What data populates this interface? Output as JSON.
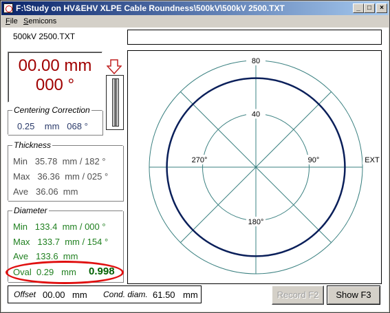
{
  "window": {
    "title": "F:\\Study on HV&EHV XLPE Cable Roundness\\500kV\\500kV 2500.TXT",
    "minimize": "_",
    "maximize": "□",
    "close": "×"
  },
  "menu": [
    {
      "label": "File",
      "accel": "F"
    },
    {
      "label": "Semicons",
      "accel": "S"
    }
  ],
  "file_label": "500kV 2500.TXT",
  "status_text": "",
  "reading": {
    "line1": "00.00 mm",
    "line2": "000  °"
  },
  "centering": {
    "legend": "Centering Correction",
    "value": "0.25",
    "unit": "mm",
    "angle": "068 °"
  },
  "thickness": {
    "legend": "Thickness",
    "rows": [
      {
        "label": "Min",
        "value": "35.78",
        "unit": "mm / 182 °"
      },
      {
        "label": "Max",
        "value": "36.36",
        "unit": "mm / 025 °"
      },
      {
        "label": "Ave",
        "value": "36.06",
        "unit": "mm"
      }
    ]
  },
  "diameter": {
    "legend": "Diameter",
    "rows": [
      {
        "label": "Min",
        "value": "133.4",
        "unit": "mm / 000 °"
      },
      {
        "label": "Max",
        "value": "133.7",
        "unit": "mm / 154 °"
      },
      {
        "label": "Ave",
        "value": "133.6",
        "unit": "mm"
      }
    ],
    "oval": {
      "label": "Oval",
      "value": "0.29",
      "unit": "mm",
      "ratio": "0.998"
    }
  },
  "offset": {
    "label": "Offset",
    "value": "00.00",
    "unit": "mm"
  },
  "cond_diam": {
    "label": "Cond. diam.",
    "value": "61.50",
    "unit": "mm"
  },
  "buttons": {
    "record": "Record F2",
    "show": "Show F3"
  },
  "polar": {
    "ring_labels": [
      "80",
      "40"
    ],
    "angle_labels": {
      "left": "270°",
      "right": "90°",
      "bottom": "180°",
      "ext": "EXT"
    },
    "outer_max": 80,
    "inner_ring": 40,
    "profile_radius": 66.8
  },
  "colors": {
    "reading_text": "#a00000",
    "thickness_text": "#505050",
    "diameter_text": "#208020",
    "oval_ratio": "#006000",
    "grid": "#3a8080",
    "profile": "#0a1f5a",
    "annotation": "#e01010",
    "title_bar": "#0a246a"
  }
}
